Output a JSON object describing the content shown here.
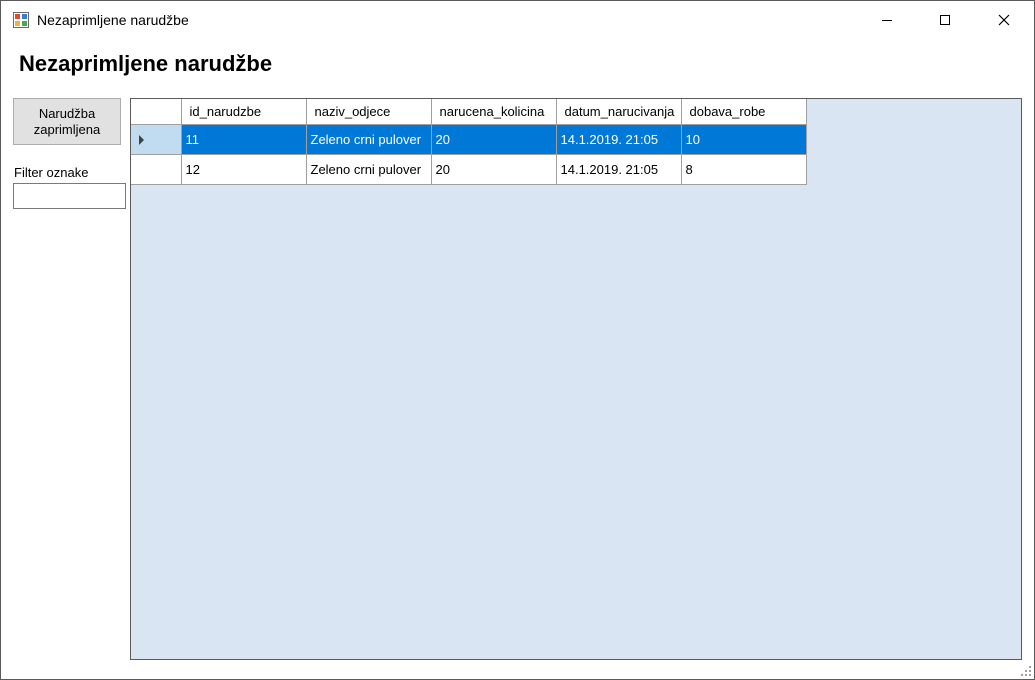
{
  "window": {
    "title": "Nezaprimljene narudžbe"
  },
  "page": {
    "heading": "Nezaprimljene narudžbe"
  },
  "sidebar": {
    "received_button_label": "Narudžba\nzaprimljena",
    "filter_label": "Filter oznake",
    "filter_value": ""
  },
  "grid": {
    "columns": [
      "id_narudzbe",
      "naziv_odjece",
      "narucena_kolicina",
      "datum_narucivanja",
      "dobava_robe"
    ],
    "rows": [
      {
        "selected": true,
        "cells": [
          "11",
          "Zeleno crni pulover",
          "20",
          "14.1.2019. 21:05",
          "10"
        ]
      },
      {
        "selected": false,
        "cells": [
          "12",
          "Zeleno crni pulover",
          "20",
          "14.1.2019. 21:05",
          "8"
        ]
      }
    ],
    "selection_color": "#0078d7",
    "background_color": "#d9e5f2"
  }
}
